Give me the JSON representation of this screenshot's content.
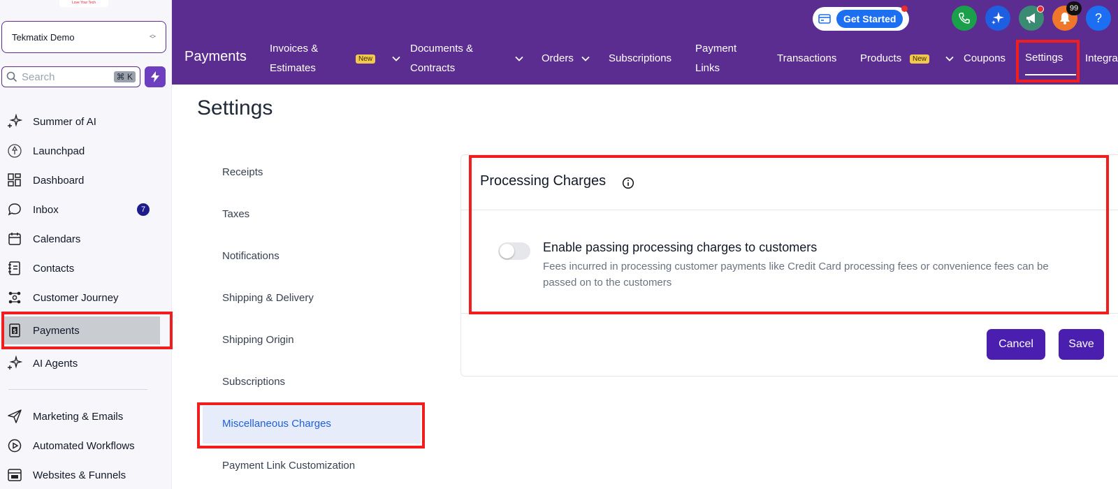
{
  "sidebar": {
    "logo_text": "Love Your Tech",
    "account_name": "Tekmatix Demo",
    "search_placeholder": "Search",
    "search_shortcut": "⌘ K",
    "items": [
      {
        "label": "Summer of AI",
        "icon": "sparkle-icon"
      },
      {
        "label": "Launchpad",
        "icon": "rocket-icon"
      },
      {
        "label": "Dashboard",
        "icon": "grid-icon"
      },
      {
        "label": "Inbox",
        "icon": "chat-bubble-icon",
        "badge": "7"
      },
      {
        "label": "Calendars",
        "icon": "calendar-icon"
      },
      {
        "label": "Contacts",
        "icon": "contacts-book-icon"
      },
      {
        "label": "Customer Journey",
        "icon": "journey-icon"
      },
      {
        "label": "Payments",
        "icon": "dollar-receipt-icon",
        "active": true
      },
      {
        "label": "AI Agents",
        "icon": "sparkle-icon"
      },
      {
        "label": "Marketing & Emails",
        "icon": "send-icon"
      },
      {
        "label": "Automated Workflows",
        "icon": "play-circle-icon"
      },
      {
        "label": "Websites & Funnels",
        "icon": "browser-icon"
      }
    ]
  },
  "topbar": {
    "get_started": "Get Started",
    "notification_count": "99",
    "help": "?",
    "module_title": "Payments",
    "tabs": [
      {
        "label_line1": "Invoices &",
        "label_line2": "Estimates",
        "new": "New"
      },
      {
        "label_line1": "Documents &",
        "label_line2": "Contracts"
      },
      {
        "label": "Orders"
      },
      {
        "label": "Subscriptions"
      },
      {
        "label_line1": "Payment",
        "label_line2": "Links"
      },
      {
        "label": "Transactions"
      },
      {
        "label": "Products",
        "new": "New"
      },
      {
        "label": "Coupons"
      },
      {
        "label": "Settings",
        "active": true
      },
      {
        "label": "Integra"
      }
    ]
  },
  "main": {
    "page_title": "Settings",
    "settings_menu": [
      "Receipts",
      "Taxes",
      "Notifications",
      "Shipping & Delivery",
      "Shipping Origin",
      "Subscriptions",
      "Miscellaneous Charges",
      "Payment Link Customization"
    ],
    "active_menu": "Miscellaneous Charges",
    "card": {
      "title": "Processing Charges",
      "option_title": "Enable passing processing charges to customers",
      "option_desc": "Fees incurred in processing customer payments like Credit Card processing fees or convenience fees can be passed on to the customers",
      "toggle_on": false,
      "cancel": "Cancel",
      "save": "Save"
    }
  },
  "colors": {
    "brand_purple": "#5b2d91",
    "button_purple": "#4a1fb0",
    "highlight_red": "#f01e1e",
    "active_link_blue": "#1d5fe0"
  }
}
